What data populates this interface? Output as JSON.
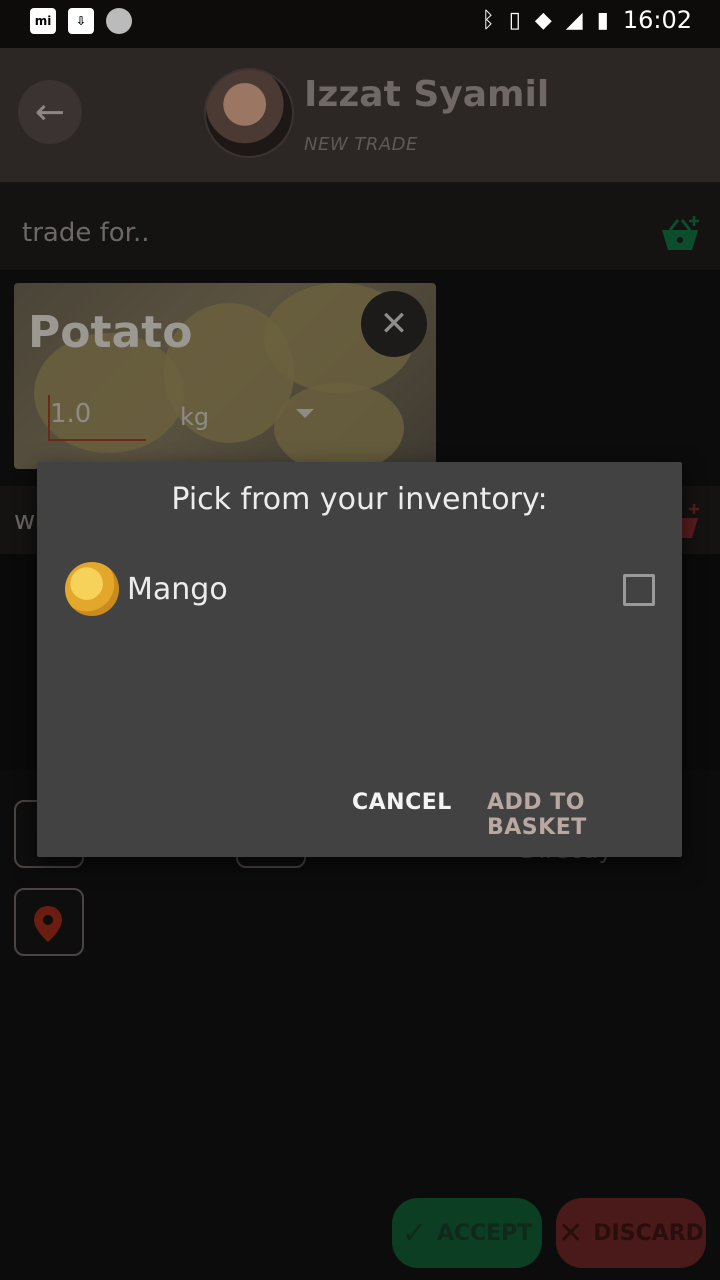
{
  "status_bar": {
    "time": "16:02",
    "left_icons": [
      "mi-icon",
      "download-icon",
      "sync-icon"
    ],
    "right_icons": [
      "bluetooth-icon",
      "vibrate-icon",
      "wifi-icon",
      "signal-icon",
      "battery-icon"
    ]
  },
  "header": {
    "name": "Izzat Syamil",
    "subtitle": "NEW TRADE"
  },
  "trade_for": {
    "label": "trade for.."
  },
  "card": {
    "title": "Potato",
    "quantity": "1.0",
    "unit": "kg"
  },
  "want_row": {
    "label": "w"
  },
  "lower": {
    "option_text": "Directly"
  },
  "dialog": {
    "title": "Pick from  your  inventory:",
    "items": [
      {
        "label": "Mango",
        "checked": false
      }
    ],
    "cancel_label": "CANCEL",
    "add_label": "ADD TO BASKET"
  },
  "actions": {
    "accept_label": "ACCEPT",
    "discard_label": "DISCARD"
  },
  "colors": {
    "accent_green": "#0c3e24",
    "accent_red": "#4a1a1a",
    "dialog_bg": "#424242"
  }
}
